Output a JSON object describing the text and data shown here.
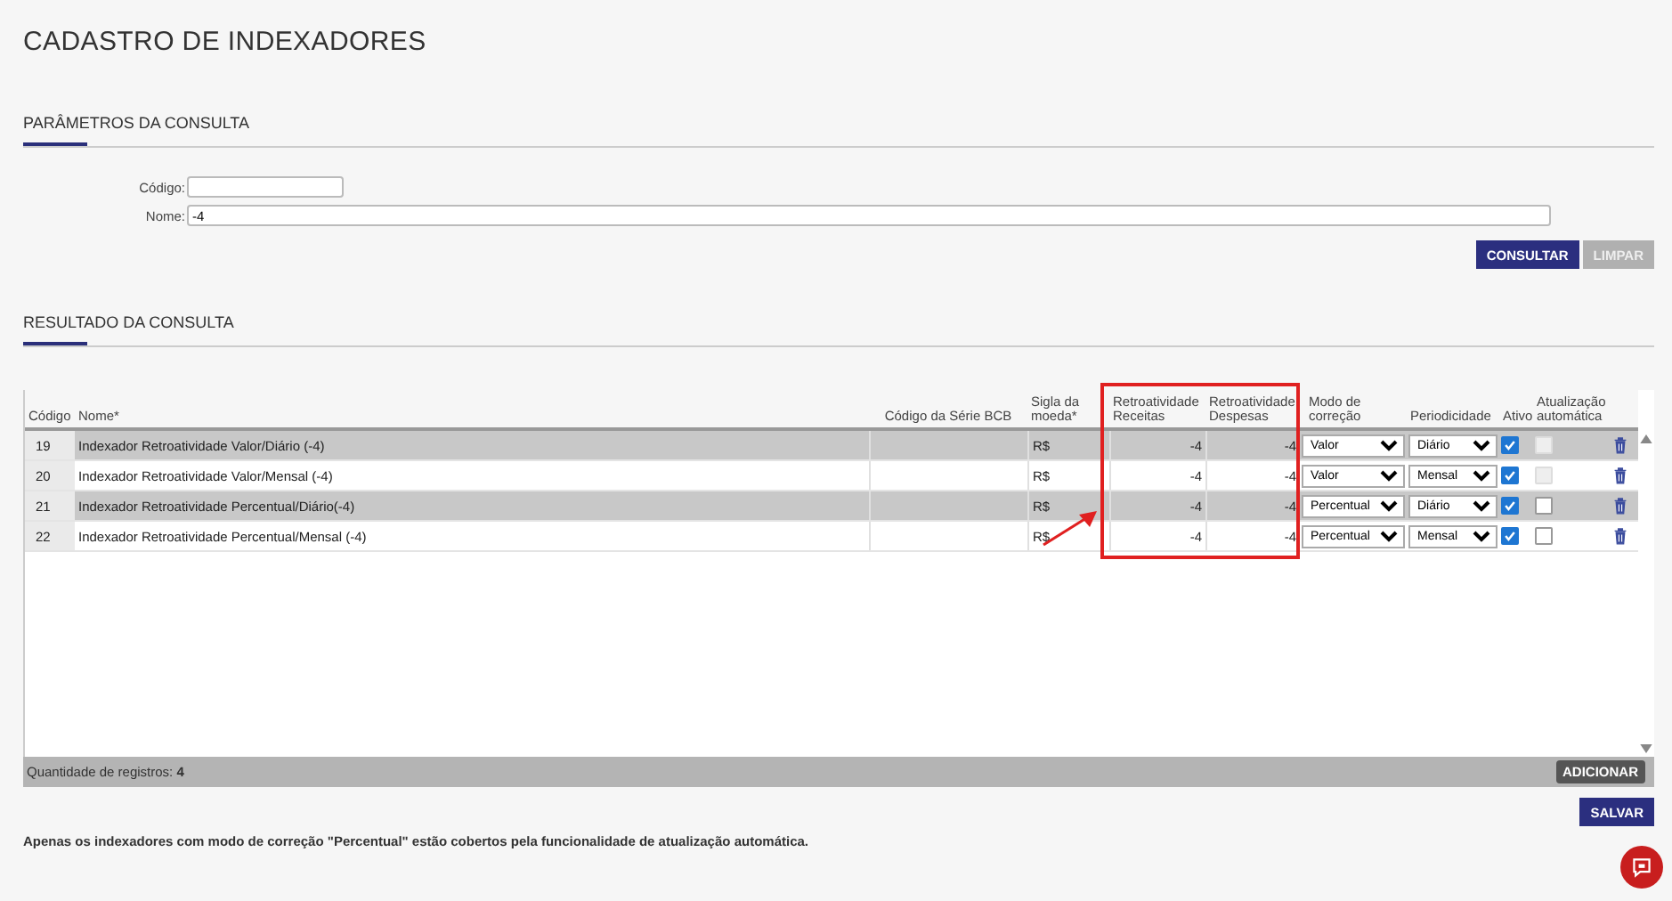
{
  "page_title": "CADASTRO DE INDEXADORES",
  "query_section": {
    "title": "PARÂMETROS DA CONSULTA",
    "fields": [
      {
        "label": "Código:",
        "kind": "short"
      },
      {
        "label": "Nome:",
        "value": "-4",
        "kind": "long"
      }
    ],
    "buttons": [
      {
        "label": "CONSULTAR",
        "disabled": false
      },
      {
        "label": "LIMPAR",
        "disabled": true
      }
    ]
  },
  "result_section": {
    "title": "RESULTADO DA CONSULTA",
    "columns": [
      "Código",
      "Nome*",
      "Código da Série BCB",
      "Sigla da moeda*",
      "Retroatividade Receitas",
      "Retroatividade Despesas",
      "Modo de correção",
      "Periodicidade",
      "Ativo",
      "Atualização automática"
    ],
    "rows": [
      {
        "codigo": "19",
        "nome": "Indexador Retroatividade Valor/Diário (-4)",
        "sigla": "R$",
        "receitas": "-4",
        "despesas": "-4",
        "modo": "Valor",
        "periodicidade": "Diário",
        "ativo": true,
        "atualizacao": false,
        "atualizacao_disabled": true,
        "selected": true
      },
      {
        "codigo": "20",
        "nome": "Indexador Retroatividade Valor/Mensal (-4)",
        "sigla": "R$",
        "receitas": "-4",
        "despesas": "-4",
        "modo": "Valor",
        "periodicidade": "Mensal",
        "ativo": true,
        "atualizacao": false,
        "atualizacao_disabled": true,
        "selected": false
      },
      {
        "codigo": "21",
        "nome": "Indexador Retroatividade Percentual/Diário(-4)",
        "sigla": "R$",
        "receitas": "-4",
        "despesas": "-4",
        "modo": "Percentual",
        "periodicidade": "Diário",
        "ativo": true,
        "atualizacao": false,
        "atualizacao_disabled": false,
        "selected": true
      },
      {
        "codigo": "22",
        "nome": "Indexador Retroatividade Percentual/Mensal (-4)",
        "sigla": "R$",
        "receitas": "-4",
        "despesas": "-4",
        "modo": "Percentual",
        "periodicidade": "Mensal",
        "ativo": true,
        "atualizacao": false,
        "atualizacao_disabled": false,
        "selected": false
      }
    ],
    "record_count_label": "Quantidade de registros:",
    "record_count": "4",
    "add_button": "ADICIONAR"
  },
  "save_button": "SALVAR",
  "note": "Apenas os indexadores com modo de correção \"Percentual\" estão cobertos pela funcionalidade de atualização automática."
}
